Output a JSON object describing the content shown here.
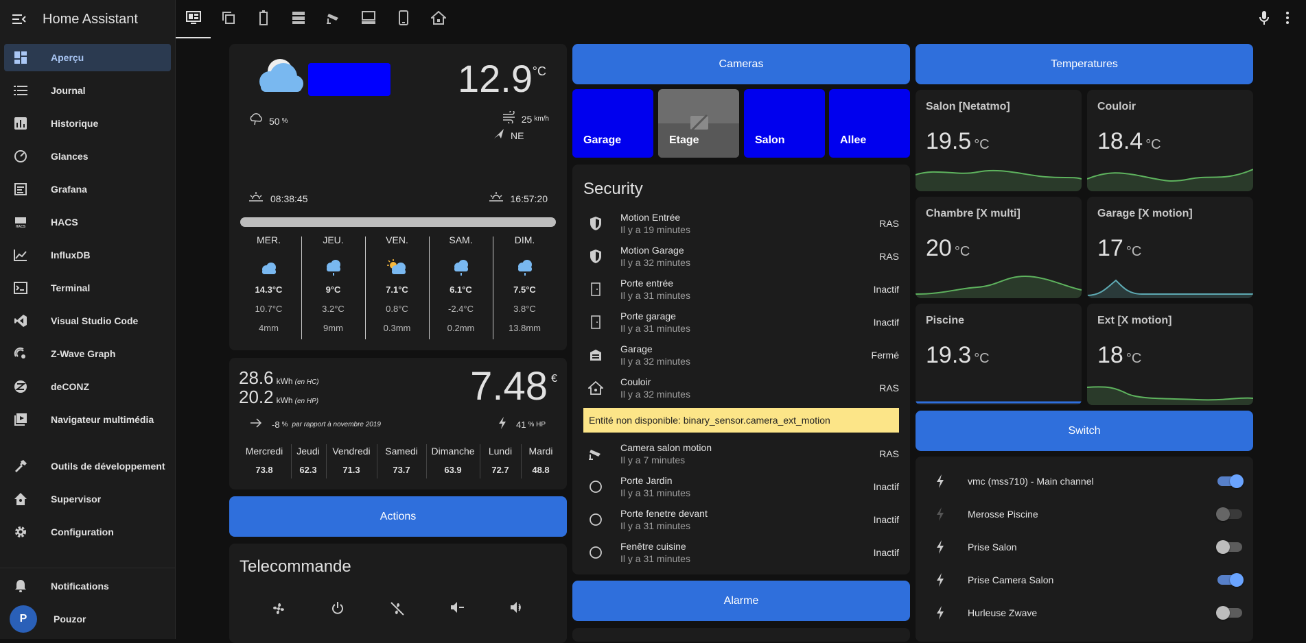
{
  "app": {
    "title": "Home Assistant"
  },
  "sidebar": {
    "items": [
      {
        "label": "Aperçu",
        "icon": "dashboard-icon"
      },
      {
        "label": "Journal",
        "icon": "list-icon"
      },
      {
        "label": "Historique",
        "icon": "chart-bar-icon"
      },
      {
        "label": "Glances",
        "icon": "gauge-icon"
      },
      {
        "label": "Grafana",
        "icon": "chart-box-icon"
      },
      {
        "label": "HACS",
        "icon": "hacs-icon"
      },
      {
        "label": "InfluxDB",
        "icon": "chart-line-icon"
      },
      {
        "label": "Terminal",
        "icon": "console-icon"
      },
      {
        "label": "Visual Studio Code",
        "icon": "vscode-icon"
      },
      {
        "label": "Z-Wave Graph",
        "icon": "zwave-icon"
      },
      {
        "label": "deCONZ",
        "icon": "zigbee-icon"
      },
      {
        "label": "Navigateur multimédia",
        "icon": "media-icon"
      }
    ],
    "tools": [
      {
        "label": "Outils de développement",
        "icon": "hammer-icon"
      },
      {
        "label": "Supervisor",
        "icon": "home-assistant-icon"
      },
      {
        "label": "Configuration",
        "icon": "cog-icon"
      }
    ],
    "notifications": "Notifications",
    "user": {
      "initial": "P",
      "name": "Pouzor"
    }
  },
  "weather": {
    "temp": "12.9",
    "unit": "°C",
    "precip": "50",
    "precip_unit": "%",
    "wind": "25",
    "wind_unit": "km/h",
    "wind_dir": "NE",
    "sunrise": "08:38:45",
    "sunset": "16:57:20",
    "forecast": [
      {
        "day": "MER.",
        "hi": "14.3°C",
        "lo": "10.7°C",
        "pr": "4mm"
      },
      {
        "day": "JEU.",
        "hi": "9°C",
        "lo": "3.2°C",
        "pr": "9mm"
      },
      {
        "day": "VEN.",
        "hi": "7.1°C",
        "lo": "0.8°C",
        "pr": "0.3mm"
      },
      {
        "day": "SAM.",
        "hi": "6.1°C",
        "lo": "-2.4°C",
        "pr": "0.2mm"
      },
      {
        "day": "DIM.",
        "hi": "7.5°C",
        "lo": "3.8°C",
        "pr": "13.8mm"
      }
    ]
  },
  "energy": {
    "hc_val": "28.6",
    "hp_val": "20.2",
    "unit": "kWh",
    "hc_note": "(en HC)",
    "hp_note": "(en HP)",
    "total": "7.48",
    "currency": "€",
    "trend": "-8",
    "trend_unit": "%",
    "trend_note": "par rapport à novembre 2019",
    "hp_pct": "41",
    "hp_pct_unit": "% HP",
    "days": [
      {
        "day": "Mercredi",
        "val": "73.8"
      },
      {
        "day": "Jeudi",
        "val": "62.3"
      },
      {
        "day": "Vendredi",
        "val": "71.3"
      },
      {
        "day": "Samedi",
        "val": "73.7"
      },
      {
        "day": "Dimanche",
        "val": "63.9"
      },
      {
        "day": "Lundi",
        "val": "72.7"
      },
      {
        "day": "Mardi",
        "val": "48.8"
      }
    ]
  },
  "buttons": {
    "actions": "Actions",
    "cameras": "Cameras",
    "temperatures": "Temperatures",
    "switch": "Switch",
    "alarme": "Alarme"
  },
  "telecommande": {
    "title": "Telecommande",
    "icons": [
      "fan-icon",
      "power-icon",
      "fan-off-icon",
      "volume-minus-icon",
      "volume-plus-icon"
    ]
  },
  "cameras": [
    "Garage",
    "Etage",
    "Salon",
    "Allee"
  ],
  "security": {
    "title": "Security",
    "rows": [
      {
        "name": "Motion Entrée",
        "sub": "Il y a 19 minutes",
        "state": "RAS",
        "icon": "shield-icon"
      },
      {
        "name": "Motion Garage",
        "sub": "Il y a 32 minutes",
        "state": "RAS",
        "icon": "shield-icon"
      },
      {
        "name": "Porte entrée",
        "sub": "Il y a 31 minutes",
        "state": "Inactif",
        "icon": "door-icon"
      },
      {
        "name": "Porte garage",
        "sub": "Il y a 31 minutes",
        "state": "Inactif",
        "icon": "door-icon"
      },
      {
        "name": "Garage",
        "sub": "Il y a 32 minutes",
        "state": "Fermé",
        "icon": "garage-icon"
      },
      {
        "name": "Couloir",
        "sub": "Il y a 32 minutes",
        "state": "RAS",
        "icon": "home-icon"
      }
    ],
    "warning": "Entité non disponible: binary_sensor.camera_ext_motion",
    "rows2": [
      {
        "name": "Camera salon motion",
        "sub": "Il y a 7 minutes",
        "state": "RAS",
        "icon": "cctv-icon"
      },
      {
        "name": "Porte Jardin",
        "sub": "Il y a 31 minutes",
        "state": "Inactif",
        "icon": "circle-icon"
      },
      {
        "name": "Porte fenetre devant",
        "sub": "Il y a 31 minutes",
        "state": "Inactif",
        "icon": "circle-icon"
      },
      {
        "name": "Fenêtre cuisine",
        "sub": "Il y a 31 minutes",
        "state": "Inactif",
        "icon": "circle-icon"
      }
    ]
  },
  "temps": [
    {
      "label": "Salon [Netatmo]",
      "val": "19.5",
      "unit": "°C",
      "color": "#5eb35e"
    },
    {
      "label": "Couloir",
      "val": "18.4",
      "unit": "°C",
      "color": "#5eb35e"
    },
    {
      "label": "Chambre [X multi]",
      "val": "20",
      "unit": "°C",
      "color": "#5eb35e"
    },
    {
      "label": "Garage [X motion]",
      "val": "17",
      "unit": "°C",
      "color": "#5eaab3"
    },
    {
      "label": "Piscine",
      "val": "19.3",
      "unit": "°C",
      "color": "#2f6fdc"
    },
    {
      "label": "Ext [X motion]",
      "val": "18",
      "unit": "°C",
      "color": "#5eb35e"
    }
  ],
  "switches": [
    {
      "label": "vmc (mss710) - Main channel",
      "on": true
    },
    {
      "label": "Merosse Piscine",
      "on": false
    },
    {
      "label": "Prise Salon",
      "on": false
    },
    {
      "label": "Prise Camera Salon",
      "on": true
    },
    {
      "label": "Hurleuse Zwave",
      "on": false
    }
  ],
  "colors": {
    "accent": "#2f6fdc",
    "warning": "#fce588",
    "active_bg": "#2b3a50"
  }
}
